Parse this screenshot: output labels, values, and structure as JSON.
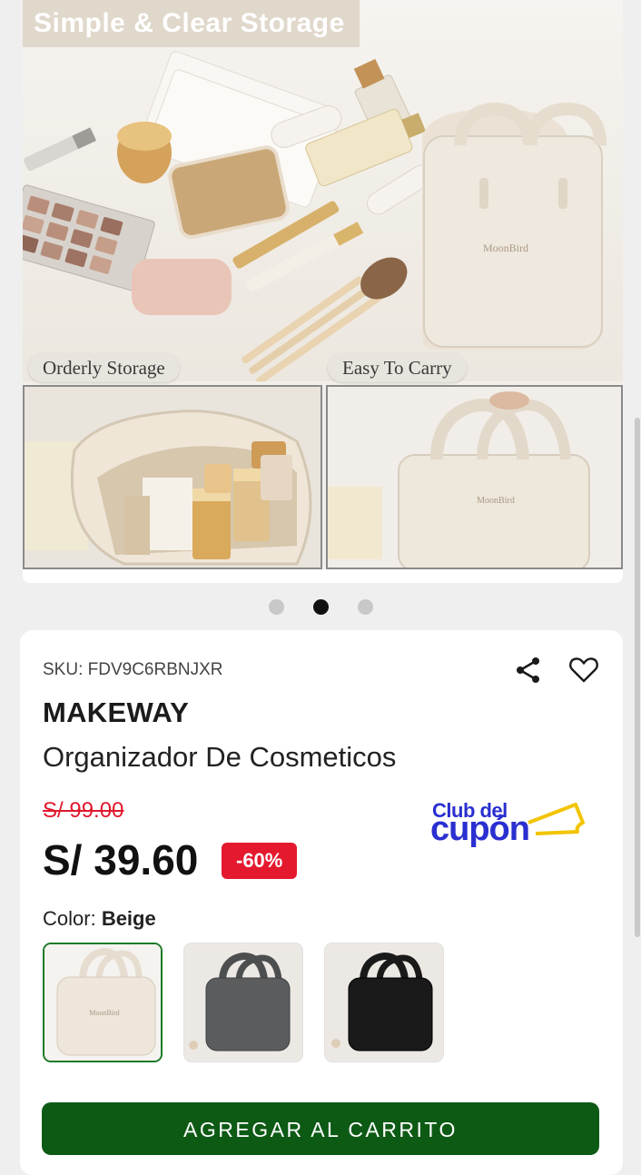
{
  "gallery": {
    "banner": "Simple & Clear Storage",
    "caption_left": "Orderly Storage",
    "caption_right": "Easy To Carry",
    "dots": 3,
    "active_dot": 2
  },
  "product": {
    "sku": "SKU: FDV9C6RBNJXR",
    "brand": "MAKEWAY",
    "name": "Organizador De Cosmeticos",
    "old_price": "S/ 99.00",
    "price": "S/ 39.60",
    "discount": "-60%"
  },
  "promo": {
    "line1": "Club del",
    "line2": "cupón",
    "color": "#2a2fd0",
    "accent": "#f2c400"
  },
  "color_selector": {
    "label": "Color:",
    "selected": "Beige",
    "options": [
      {
        "name": "Beige",
        "hex": "#eee6da",
        "selected": true
      },
      {
        "name": "Gray",
        "hex": "#5b5c5e",
        "selected": false
      },
      {
        "name": "Black",
        "hex": "#1a1a1a",
        "selected": false
      }
    ]
  },
  "actions": {
    "add_to_cart": "AGREGAR AL CARRITO",
    "share_icon": "share-icon",
    "favorite_icon": "heart-icon"
  },
  "colors": {
    "primary_button": "#0d5a15",
    "discount_badge": "#e4192d",
    "old_price": "#e0192f"
  }
}
